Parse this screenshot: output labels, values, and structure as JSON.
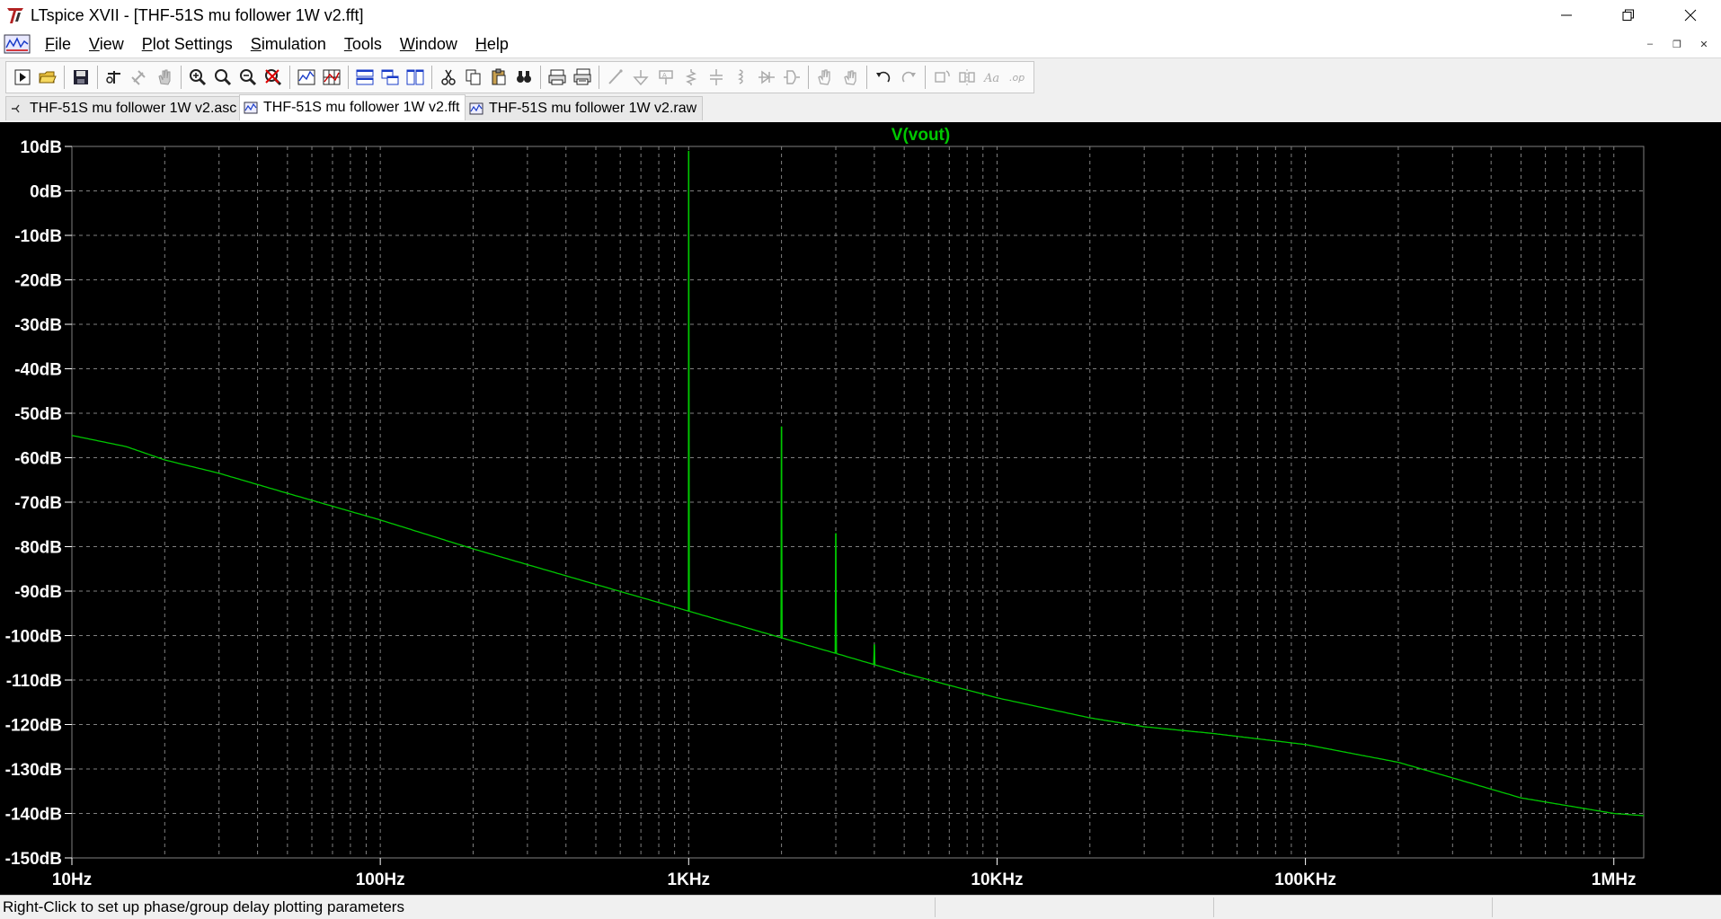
{
  "window": {
    "title": "LTspice XVII - [THF-51S mu follower 1W v2.fft]"
  },
  "menu": {
    "items": [
      {
        "label": "File",
        "accel": "F",
        "rest": "ile"
      },
      {
        "label": "View",
        "accel": "V",
        "rest": "iew"
      },
      {
        "label": "Plot Settings",
        "accel": "P",
        "rest": "lot Settings"
      },
      {
        "label": "Simulation",
        "accel": "S",
        "rest": "imulation"
      },
      {
        "label": "Tools",
        "accel": "T",
        "rest": "ools"
      },
      {
        "label": "Window",
        "accel": "W",
        "rest": "indow"
      },
      {
        "label": "Help",
        "accel": "H",
        "rest": "elp"
      }
    ]
  },
  "toolbar": {
    "buttons": [
      {
        "name": "run-icon",
        "enabled": true
      },
      {
        "name": "open-icon",
        "enabled": true
      },
      {
        "name": "save-icon",
        "enabled": true
      },
      {
        "name": "control-panel-icon",
        "enabled": true
      },
      {
        "name": "halt-icon",
        "enabled": false
      },
      {
        "name": "pan-hand-icon",
        "enabled": false
      },
      {
        "name": "zoom-in-icon",
        "enabled": true
      },
      {
        "name": "zoom-area-icon",
        "enabled": true
      },
      {
        "name": "zoom-out-icon",
        "enabled": true
      },
      {
        "name": "zoom-cancel-icon",
        "enabled": true
      },
      {
        "name": "autorange-icon",
        "enabled": true
      },
      {
        "name": "grid-icon",
        "enabled": true
      },
      {
        "name": "tile-horizontal-icon",
        "enabled": true
      },
      {
        "name": "cascade-icon",
        "enabled": true
      },
      {
        "name": "tile-vertical-icon",
        "enabled": true
      },
      {
        "name": "cut-icon",
        "enabled": true
      },
      {
        "name": "copy-icon",
        "enabled": true
      },
      {
        "name": "paste-icon",
        "enabled": true
      },
      {
        "name": "find-icon",
        "enabled": true
      },
      {
        "name": "print-icon",
        "enabled": true
      },
      {
        "name": "print-setup-icon",
        "enabled": true
      },
      {
        "name": "wire-icon",
        "enabled": false
      },
      {
        "name": "ground-icon",
        "enabled": false
      },
      {
        "name": "label-icon",
        "enabled": false
      },
      {
        "name": "resistor-icon",
        "enabled": false
      },
      {
        "name": "capacitor-icon",
        "enabled": false
      },
      {
        "name": "inductor-icon",
        "enabled": false
      },
      {
        "name": "diode-icon",
        "enabled": false
      },
      {
        "name": "component-icon",
        "enabled": false
      },
      {
        "name": "move-icon",
        "enabled": false
      },
      {
        "name": "drag-icon",
        "enabled": false
      },
      {
        "name": "undo-icon",
        "enabled": true
      },
      {
        "name": "redo-icon",
        "enabled": false
      },
      {
        "name": "rotate-icon",
        "enabled": false
      },
      {
        "name": "mirror-icon",
        "enabled": false
      },
      {
        "name": "text-icon",
        "enabled": false
      },
      {
        "name": "spice-directive-icon",
        "enabled": false
      }
    ]
  },
  "tabs": [
    {
      "label": "THF-51S mu follower 1W v2.asc",
      "icon": "schematic-icon",
      "active": false
    },
    {
      "label": "THF-51S mu follower 1W v2.fft",
      "icon": "waveform-icon",
      "active": true
    },
    {
      "label": "THF-51S mu follower 1W v2.raw",
      "icon": "waveform-icon",
      "active": false
    }
  ],
  "status": {
    "text": "Right-Click to set up phase/group delay plotting parameters"
  },
  "colors": {
    "plot_background": "#000000",
    "trace": "#00c800",
    "trace_label": "#00c800",
    "grid": "#808080",
    "axis_text": "#ffffff"
  },
  "chart_data": {
    "type": "line",
    "title": "V(vout)",
    "xscale": "log",
    "xlim": [
      10,
      1250000
    ],
    "ylim": [
      -150,
      10
    ],
    "x_ticks": [
      {
        "value": 10,
        "label": "10Hz"
      },
      {
        "value": 100,
        "label": "100Hz"
      },
      {
        "value": 1000,
        "label": "1KHz"
      },
      {
        "value": 10000,
        "label": "10KHz"
      },
      {
        "value": 100000,
        "label": "100KHz"
      },
      {
        "value": 1000000,
        "label": "1MHz"
      }
    ],
    "y_ticks": [
      {
        "value": 10,
        "label": "10dB"
      },
      {
        "value": 0,
        "label": "0dB"
      },
      {
        "value": -10,
        "label": "-10dB"
      },
      {
        "value": -20,
        "label": "-20dB"
      },
      {
        "value": -30,
        "label": "-30dB"
      },
      {
        "value": -40,
        "label": "-40dB"
      },
      {
        "value": -50,
        "label": "-50dB"
      },
      {
        "value": -60,
        "label": "-60dB"
      },
      {
        "value": -70,
        "label": "-70dB"
      },
      {
        "value": -80,
        "label": "-80dB"
      },
      {
        "value": -90,
        "label": "-90dB"
      },
      {
        "value": -100,
        "label": "-100dB"
      },
      {
        "value": -110,
        "label": "-110dB"
      },
      {
        "value": -120,
        "label": "-120dB"
      },
      {
        "value": -130,
        "label": "-130dB"
      },
      {
        "value": -140,
        "label": "-140dB"
      },
      {
        "value": -150,
        "label": "-150dB"
      }
    ],
    "grid": true,
    "series": [
      {
        "name": "V(vout)",
        "noise_floor": {
          "x": [
            10,
            15,
            20,
            30,
            50,
            100,
            200,
            500,
            1000,
            2000,
            3000,
            5000,
            10000,
            20000,
            30000,
            50000,
            100000,
            200000,
            300000,
            500000,
            1000000,
            1250000
          ],
          "y": [
            -55,
            -57.5,
            -60.5,
            -63.5,
            -68,
            -74,
            -80.5,
            -88.5,
            -94.5,
            -100.5,
            -104,
            -108.5,
            -114,
            -118.5,
            -120.5,
            -122,
            -124.5,
            -128.5,
            -132,
            -136.5,
            -140,
            -140.5
          ]
        },
        "peaks": [
          {
            "x": 1000,
            "y": 9
          },
          {
            "x": 2000,
            "y": -53
          },
          {
            "x": 3000,
            "y": -77
          },
          {
            "x": 4000,
            "y": -102
          }
        ]
      }
    ]
  }
}
